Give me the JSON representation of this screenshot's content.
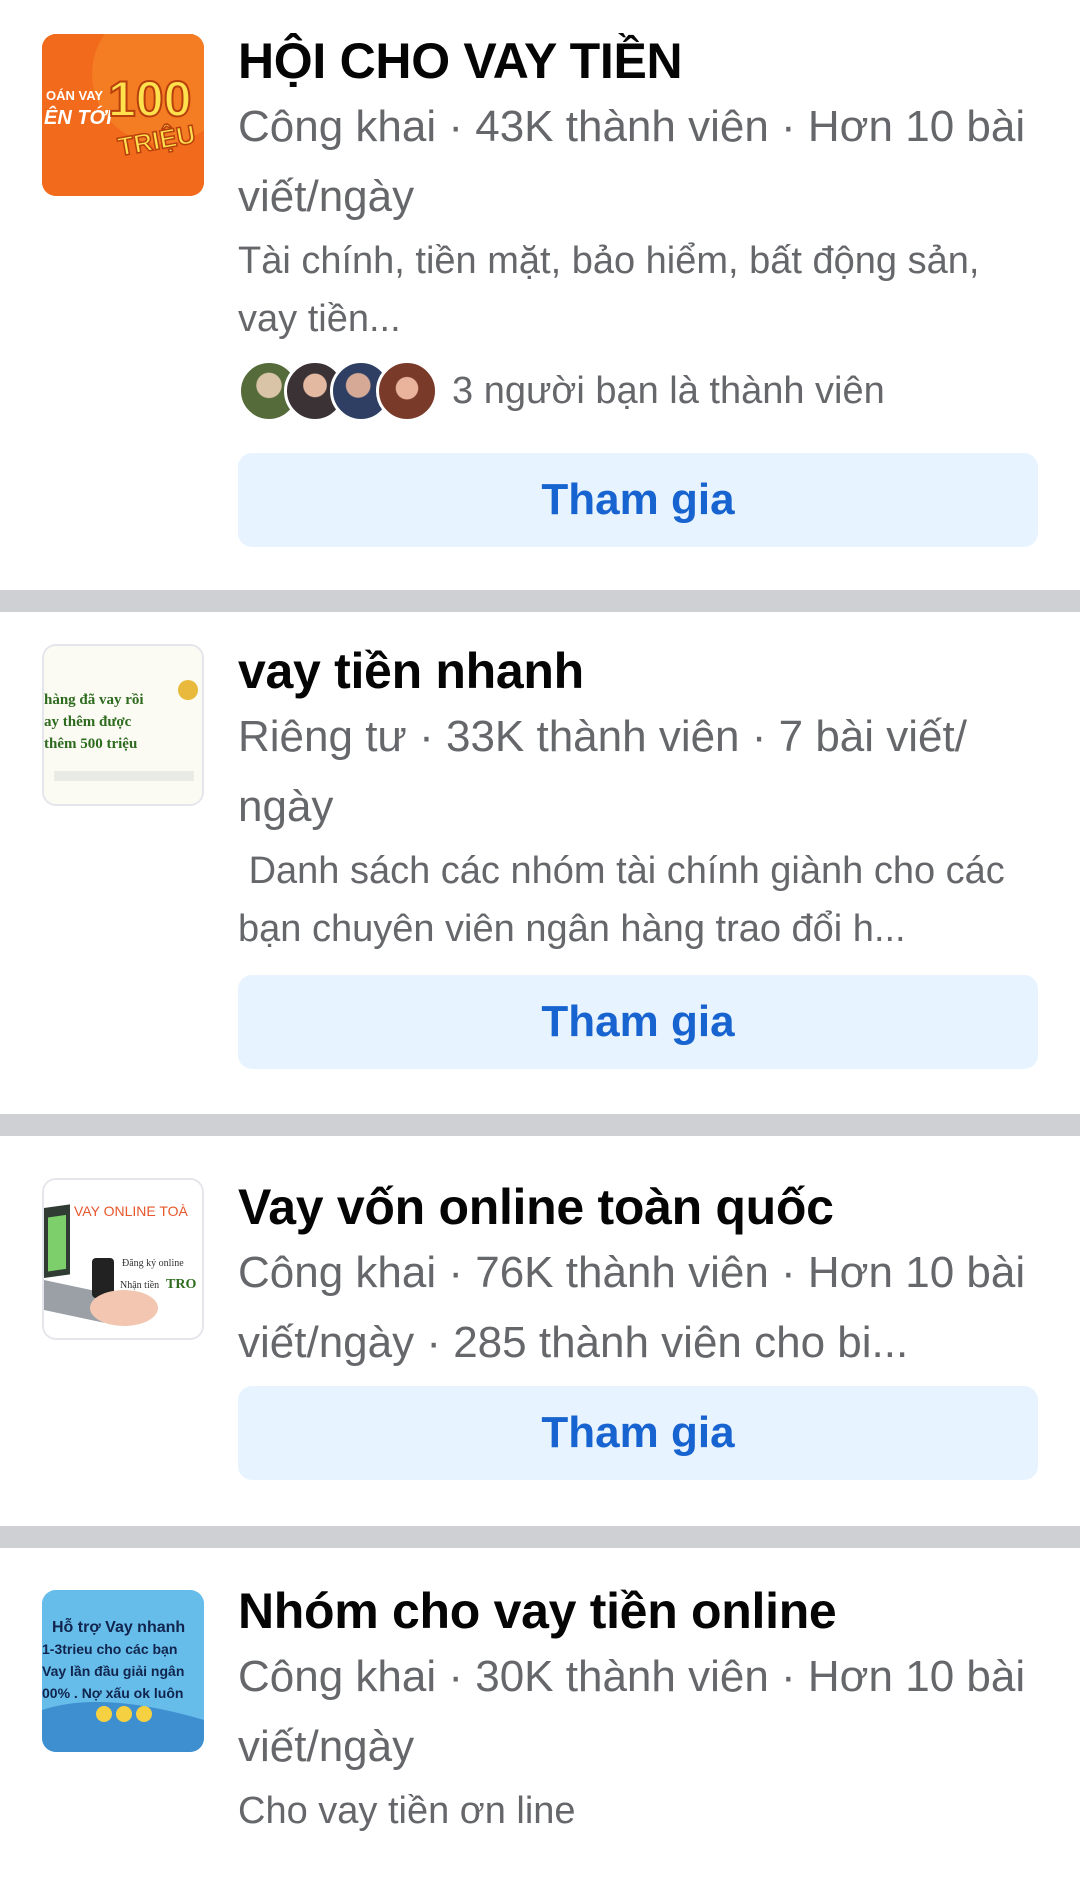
{
  "groups": [
    {
      "name": "HỘI CHO VAY TIỀN",
      "meta": "Công khai · 43K thành viên · Hơn 10 bài viết/ngày",
      "description": "Tài chính, tiền mặt, bảo hiểm, bất động sản, vay tiền...",
      "friends_text": "3 người bạn là thành viên",
      "join_label": "Tham gia",
      "thumb_text": [
        "OÁN VAY",
        "ÊN TỚI",
        "100",
        "TRIỆU"
      ]
    },
    {
      "name": "vay tiền nhanh",
      "meta": "Riêng tư · 33K thành viên · 7 bài viết/ ngày",
      "description": " Danh sách các nhóm tài chính giành cho các bạn chuyên viên ngân hàng trao đổi h...",
      "join_label": "Tham gia",
      "thumb_text": [
        "hàng đã vay rồi",
        "ay thêm được",
        "thêm 500 triệu"
      ]
    },
    {
      "name": "Vay vốn online toàn quốc",
      "meta": "Công khai · 76K thành viên · Hơn 10 bài viết/ngày · 285 thành viên cho bi...",
      "join_label": "Tham gia",
      "thumb_text": [
        "VAY ONLINE TOÀ",
        "Đăng ký online",
        "Nhận tiền",
        "TRO"
      ]
    },
    {
      "name": "Nhóm cho vay tiền online",
      "meta": "Công khai · 30K thành viên · Hơn 10 bài viết/ngày",
      "description": "Cho vay tiền ơn line",
      "thumb_text": [
        "Hỗ trợ Vay nhanh",
        "1-3trieu cho các bạn",
        "Vay lần đầu giải ngân",
        "00% . Nợ xấu ok luôn"
      ]
    }
  ],
  "colors": {
    "separator": "#ced0d4",
    "join_bg": "#e7f3ff",
    "join_text": "#1763cf",
    "meta_text": "#65676b"
  }
}
